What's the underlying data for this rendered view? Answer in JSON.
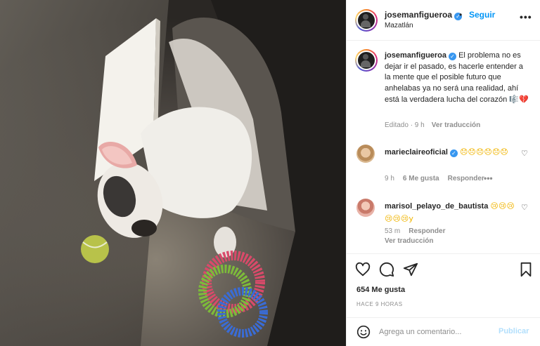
{
  "post": {
    "username": "josemanfigueroa",
    "follow_label": "Seguir",
    "separator": "•",
    "location": "Mazatlán",
    "more_label": "•••"
  },
  "caption": {
    "username": "josemanfigueroa",
    "text": "El problema no es dejar ir el pasado, es hacerle entender a la mente que el posible futuro que anhelabas ya no será una realidad, ahí está la verdadera lucha del corazón",
    "emoji": "🎼💔",
    "meta_time": "Editado · 9 h",
    "translate_label": "Ver traducción"
  },
  "comments": [
    {
      "username": "marieclaireoficial",
      "text": "😞😞😞😞😞😞",
      "time": "9 h",
      "likes": "6 Me gusta",
      "reply": "Responder",
      "more": "•••"
    },
    {
      "username": "marisol_pelayo_de_bautista",
      "text": "😢😢😢😢😢😢y",
      "time": "53 m",
      "reply": "Responder",
      "translate": "Ver traducción"
    }
  ],
  "actions": {
    "likes": "654 Me gusta",
    "time": "HACE 9 HORAS"
  },
  "composer": {
    "placeholder": "Agrega un comentario...",
    "publish_label": "Publicar"
  },
  "colors": {
    "link_blue": "#0095f6",
    "verified_blue": "#3897f0",
    "muted": "#8e8e8e",
    "publish_disabled": "#b2dffc"
  }
}
